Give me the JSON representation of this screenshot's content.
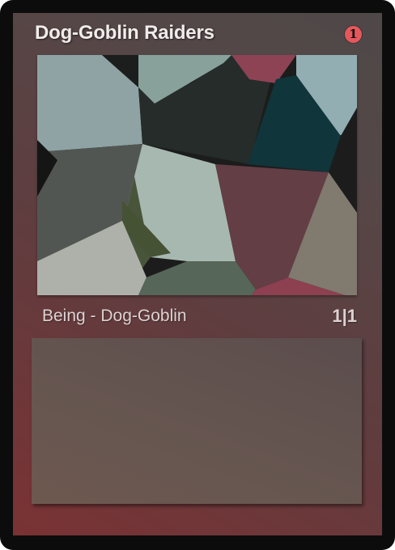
{
  "card": {
    "title": "Dog-Goblin Raiders",
    "cost": "1",
    "type_line": "Being - Dog-Goblin",
    "stats": "1|1",
    "rules_text": ""
  },
  "colors": {
    "frame": "#0c0c0c",
    "card_red": "#7a3234",
    "card_gray": "#4f4848",
    "cost_badge": "#e4585c",
    "text_box": "#655550"
  },
  "art": {
    "description_icon": "voronoi-mosaic-artwork"
  }
}
